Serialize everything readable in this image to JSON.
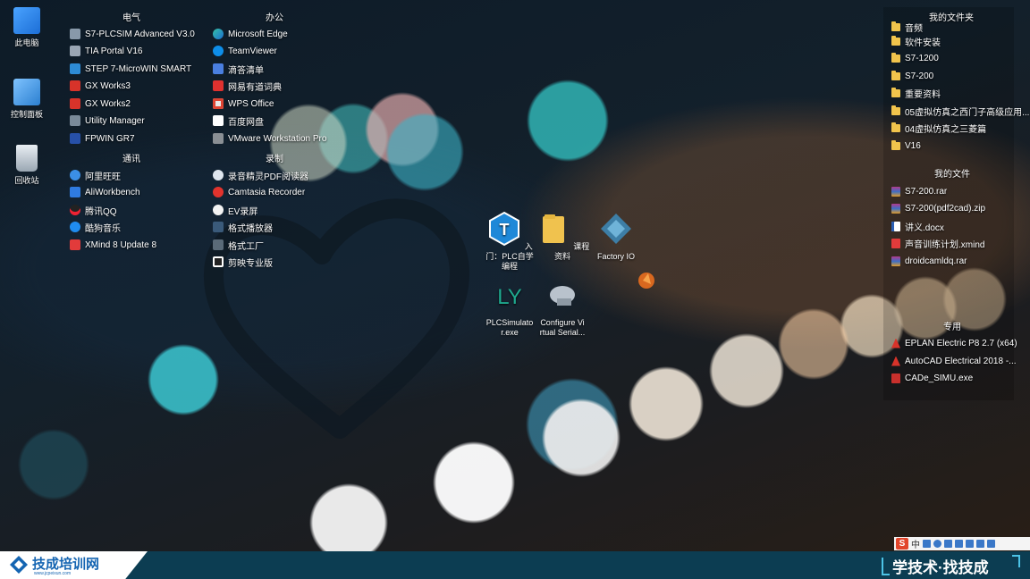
{
  "desktop_icons": [
    {
      "label": "此电脑",
      "icon": "computer-icon"
    },
    {
      "label": "控制面板",
      "icon": "control-panel-icon"
    },
    {
      "label": "回收站",
      "icon": "recycle-bin-icon"
    }
  ],
  "groups": {
    "electrical_title": "电气",
    "electrical": [
      "S7-PLCSIM Advanced V3.0",
      "TIA Portal V16",
      "STEP 7-MicroWIN SMART",
      "GX Works3",
      "GX Works2",
      "Utility Manager",
      "FPWIN GR7"
    ],
    "comm_title": "通讯",
    "comm": [
      "阿里旺旺",
      "AliWorkbench",
      "腾讯QQ",
      "酷狗音乐",
      "XMind 8 Update 8"
    ],
    "office_title": "办公",
    "office": [
      "Microsoft Edge",
      "TeamViewer",
      "滴答清单",
      "网易有道词典",
      "WPS Office",
      "百度网盘",
      "VMware Workstation Pro"
    ],
    "record_title": "录制",
    "record": [
      "录音精灵PDF阅读器",
      "Camtasia Recorder",
      "EV录屏",
      "格式播放器",
      "格式工厂",
      "剪映专业版"
    ]
  },
  "center_icons": [
    {
      "label": "入门：PLC自学编程",
      "icon": "tia-icon"
    },
    {
      "label": "课程资料",
      "icon": "folder-icon"
    },
    {
      "label": "Factory IO",
      "icon": "factory-io-icon"
    },
    {
      "label": "PLCSimulato r.exe",
      "icon": "ly-icon"
    },
    {
      "label": "Configure Vi rtual Serial...",
      "icon": "serial-port-icon"
    },
    {
      "label": "",
      "icon": "app-icon"
    }
  ],
  "right_panel": {
    "folders_title": "我的文件夹",
    "folders": [
      "音频",
      "软件安装",
      "S7-1200",
      "S7-200",
      "重要资料",
      "05虚拟仿真之西门子高级应用...",
      "04虚拟仿真之三菱篇",
      "V16"
    ],
    "files_title": "我的文件",
    "files": [
      {
        "name": "S7-200.rar",
        "icon": "rar-icon"
      },
      {
        "name": "S7-200(pdf2cad).zip",
        "icon": "zip-icon"
      },
      {
        "name": "讲义.docx",
        "icon": "docx-icon"
      },
      {
        "name": "声音训练计划.xmind",
        "icon": "xmind-icon"
      },
      {
        "name": "droidcamldq.rar",
        "icon": "rar-icon"
      }
    ],
    "tools_title": "专用",
    "tools": [
      "EPLAN Electric P8 2.7 (x64)",
      "AutoCAD Electrical 2018 -...",
      "CADe_SIMU.exe"
    ]
  },
  "branding": {
    "logo": "技成培训网",
    "logo_url": "www.jcpeixun.com",
    "slogan": "学技术·找技成"
  },
  "ime": {
    "mode": "中"
  },
  "colors": {
    "taskbar": "#0c3d52",
    "logo_blue": "#1565b2",
    "folder": "#f1c44c"
  }
}
